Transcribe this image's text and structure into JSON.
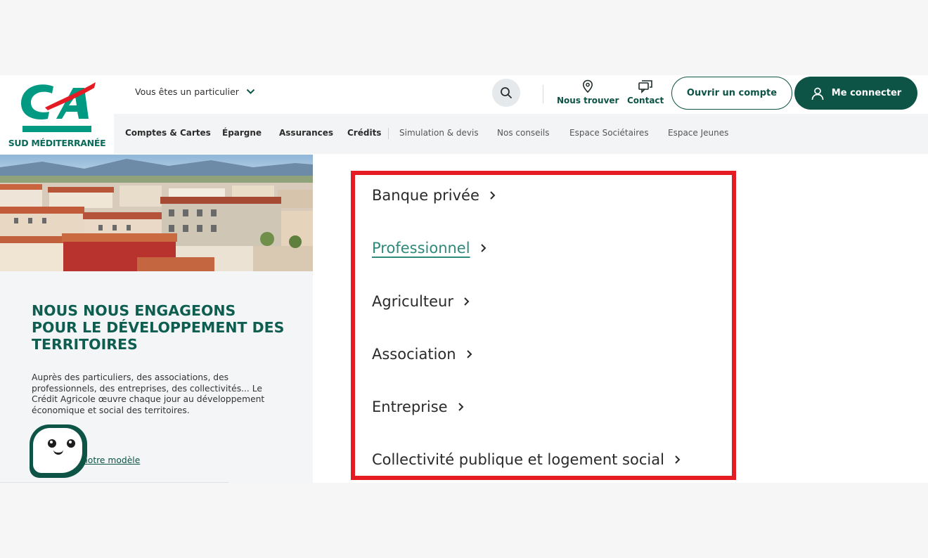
{
  "brand": {
    "logo_text": "SUD MÉDITERRANÉE",
    "primary_color": "#0d5446",
    "logo_green": "#009a83",
    "logo_red": "#e41b23"
  },
  "topbar": {
    "profile_label": "Vous êtes un particulier",
    "search_icon": "search-icon",
    "find_label": "Nous trouver",
    "contact_label": "Contact",
    "open_account_label": "Ouvrir un compte",
    "login_label": "Me connecter"
  },
  "nav": {
    "items": [
      {
        "label": "Comptes & Cartes"
      },
      {
        "label": "Épargne"
      },
      {
        "label": "Assurances"
      },
      {
        "label": "Crédits"
      },
      {
        "label": "Simulation & devis"
      },
      {
        "label": "Nos conseils"
      },
      {
        "label": "Espace Sociétaires"
      },
      {
        "label": "Espace Jeunes"
      }
    ]
  },
  "hero": {
    "title": "NOUS NOUS ENGAGEONS POUR LE DÉVELOPPEMENT DES TERRITOIRES",
    "description": "Auprès des particuliers, des associations, des professionnels, des entreprises, des collectivités... Le Crédit Agricole œuvre chaque jour au développement économique et social des territoires.",
    "link_label": "notre modèle"
  },
  "menu": {
    "highlight_color": "#e41b23",
    "items": [
      {
        "label": "Banque privée",
        "active": false
      },
      {
        "label": "Professionnel",
        "active": true
      },
      {
        "label": "Agriculteur",
        "active": false
      },
      {
        "label": "Association",
        "active": false
      },
      {
        "label": "Entreprise",
        "active": false
      },
      {
        "label": "Collectivité publique et logement social",
        "active": false
      }
    ]
  }
}
